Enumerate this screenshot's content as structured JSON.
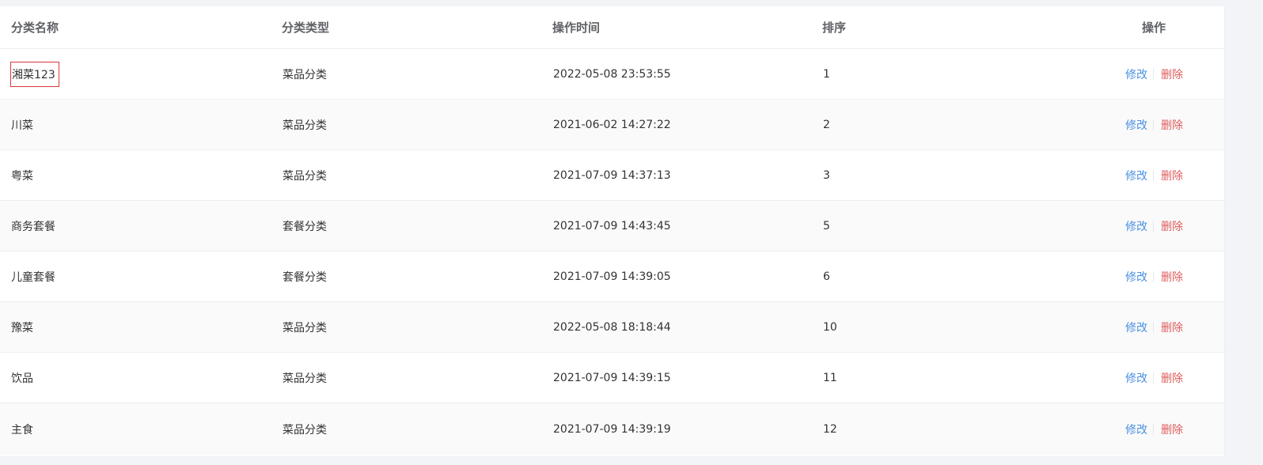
{
  "table": {
    "headers": {
      "name": "分类名称",
      "type": "分类类型",
      "time": "操作时间",
      "sort": "排序",
      "actions": "操作"
    },
    "rows": [
      {
        "name": "湘菜123",
        "type": "菜品分类",
        "time": "2022-05-08 23:53:55",
        "sort": "1",
        "edit": "修改",
        "delete": "删除"
      },
      {
        "name": "川菜",
        "type": "菜品分类",
        "time": "2021-06-02 14:27:22",
        "sort": "2",
        "edit": "修改",
        "delete": "删除"
      },
      {
        "name": "粤菜",
        "type": "菜品分类",
        "time": "2021-07-09 14:37:13",
        "sort": "3",
        "edit": "修改",
        "delete": "删除"
      },
      {
        "name": "商务套餐",
        "type": "套餐分类",
        "time": "2021-07-09 14:43:45",
        "sort": "5",
        "edit": "修改",
        "delete": "删除"
      },
      {
        "name": "儿童套餐",
        "type": "套餐分类",
        "time": "2021-07-09 14:39:05",
        "sort": "6",
        "edit": "修改",
        "delete": "删除"
      },
      {
        "name": "豫菜",
        "type": "菜品分类",
        "time": "2022-05-08 18:18:44",
        "sort": "10",
        "edit": "修改",
        "delete": "删除"
      },
      {
        "name": "饮品",
        "type": "菜品分类",
        "time": "2021-07-09 14:39:15",
        "sort": "11",
        "edit": "修改",
        "delete": "删除"
      },
      {
        "name": "主食",
        "type": "菜品分类",
        "time": "2021-07-09 14:39:19",
        "sort": "12",
        "edit": "修改",
        "delete": "删除"
      }
    ]
  },
  "colors": {
    "edit_link": "#4a90e2",
    "delete_link": "#e05c5c",
    "selection_border": "#d9393d",
    "stripe_row": "#fafafa"
  }
}
